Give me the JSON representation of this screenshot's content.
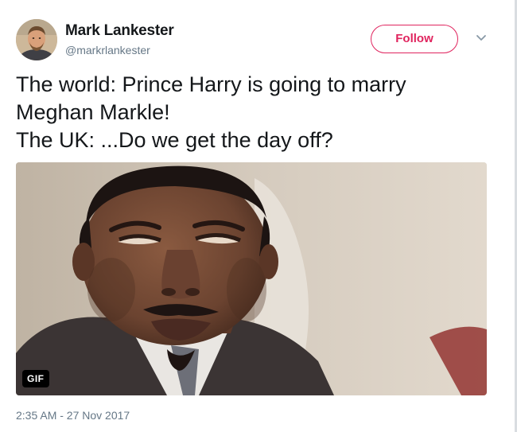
{
  "author": {
    "name": "Mark Lankester",
    "handle": "@markrlankester"
  },
  "actions": {
    "follow_label": "Follow",
    "more_icon": "chevron-down-icon"
  },
  "tweet": {
    "lines": [
      "The world: Prince Harry is going to marry",
      "Meghan Markle!",
      "The UK: ...Do we get the day off?"
    ],
    "timestamp": "2:35 AM - 27 Nov 2017"
  },
  "media": {
    "badge": "GIF"
  },
  "colors": {
    "follow_accent": "#e0245e",
    "text_primary": "#14171a",
    "text_secondary": "#657786"
  }
}
